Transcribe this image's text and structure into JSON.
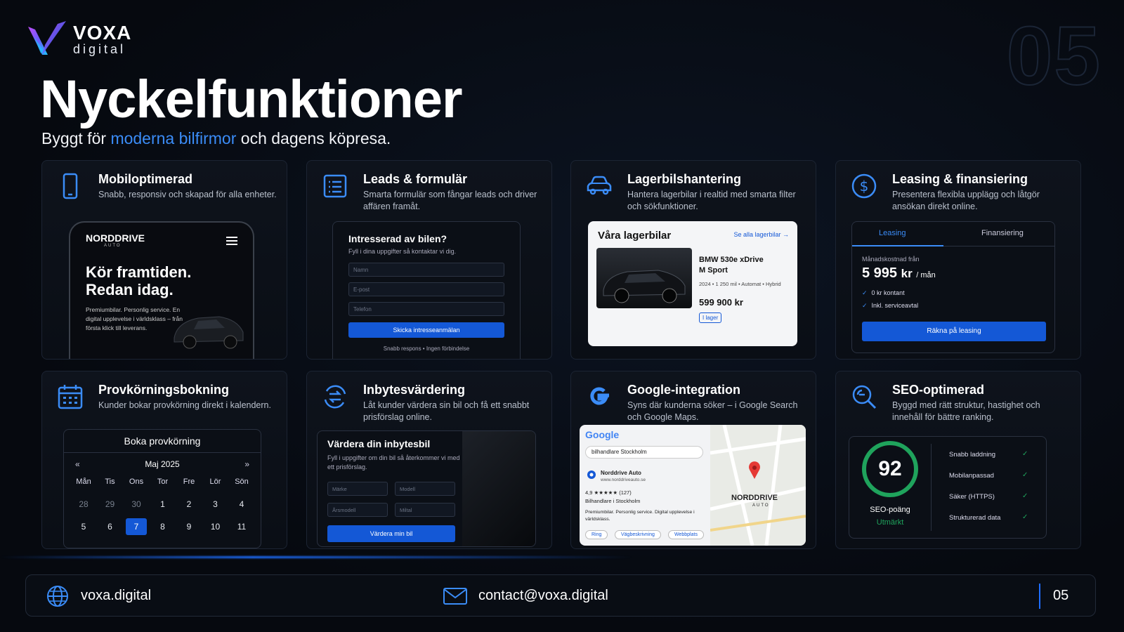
{
  "brand": {
    "name": "VOXA",
    "sub": "digital"
  },
  "page_watermark": "05",
  "title": "Nyckelfunktioner",
  "subtitle": {
    "pre": "Byggt för ",
    "highlight": "moderna bilfirmor",
    "post": " och dagens köpresa."
  },
  "colors": {
    "accent": "#3b8cf7",
    "button": "#1458d6",
    "success": "#1fa35c",
    "background": "#06090f"
  },
  "cards": {
    "mobile": {
      "icon": "phone-icon",
      "title": "Mobiloptimerad",
      "desc": "Snabb, responsiv och skapad för alla enheter.",
      "phone": {
        "brand": "NORDDRIVE",
        "brand_sub": "AUTO",
        "headline1": "Kör framtiden.",
        "headline2": "Redan idag.",
        "body": "Premiumbilar. Personlig service. En digital upplevelse i världsklass – från första klick till leverans."
      }
    },
    "leads": {
      "icon": "form-icon",
      "title": "Leads & formulär",
      "desc": "Smarta formulär som fångar leads och driver affären framåt.",
      "form": {
        "title": "Intresserad av bilen?",
        "sub": "Fyll i dina uppgifter så kontaktar vi dig.",
        "fields": [
          "Namn",
          "E-post",
          "Telefon"
        ],
        "button": "Skicka intresseanmälan",
        "note": "Snabb respons • Ingen förbindelse"
      }
    },
    "inventory": {
      "icon": "car-icon",
      "title": "Lagerbilshantering",
      "desc": "Hantera lagerbilar i realtid med smarta filter och sökfunktioner.",
      "panel": {
        "title": "Våra lagerbilar",
        "link": "Se alla lagerbilar →",
        "car_name1": "BMW 530e xDrive",
        "car_name2": "M Sport",
        "meta": "2024 • 1 250 mil • Automat • Hybrid",
        "price": "599 900 kr",
        "badge": "I lager"
      }
    },
    "leasing": {
      "icon": "dollar-icon",
      "title": "Leasing & finansiering",
      "desc": "Presentera flexibla upplägg och låtgör ansökan direkt online.",
      "panel": {
        "tab1": "Leasing",
        "tab2": "Finansiering",
        "label": "Månadskostnad från",
        "price": "5 995",
        "unit_kr": "kr",
        "unit_per": "/ mån",
        "checks": [
          "0 kr kontant",
          "Inkl. serviceavtal"
        ],
        "button": "Räkna på leasing"
      }
    },
    "testdrive": {
      "icon": "calendar-icon",
      "title": "Provkörningsbokning",
      "desc": "Kunder bokar provkörning direkt i kalendern.",
      "panel": {
        "title": "Boka provkörning",
        "month": "Maj 2025",
        "prev": "«",
        "next": "»",
        "days": [
          "Mån",
          "Tis",
          "Ons",
          "Tor",
          "Fre",
          "Lör",
          "Sön"
        ],
        "row1": [
          "28",
          "29",
          "30",
          "1",
          "2",
          "3",
          "4"
        ],
        "row2": [
          "5",
          "6",
          "7",
          "8",
          "9",
          "10",
          "11"
        ],
        "selected": "7"
      }
    },
    "tradein": {
      "icon": "exchange-icon",
      "title": "Inbytesvärdering",
      "desc": "Låt kunder värdera sin bil och få ett snabbt prisförslag online.",
      "panel": {
        "title": "Värdera din inbytesbil",
        "sub": "Fyll i uppgifter om din bil så återkommer vi med ett prisförslag.",
        "selects": [
          "Märke",
          "Modell",
          "Årsmodell",
          "Miltal"
        ],
        "button": "Värdera min bil"
      }
    },
    "google": {
      "icon": "google-icon",
      "title": "Google-integration",
      "desc": "Syns där kunderna söker – i Google Search och Google Maps.",
      "panel": {
        "logo": "Google",
        "query": "bilhandlare Stockholm",
        "business": "Norddrive Auto",
        "url": "www.norddriveauto.se",
        "rating": "4,9 ★★★★★ (127)",
        "category": "Bilhandlare i Stockholm",
        "desc": "Premiumbilar. Personlig service. Digital upplevelse i världsklass.",
        "chips": [
          "Ring",
          "Vägbeskrivning",
          "Webbplats"
        ],
        "map_label": "NORDDRIVE",
        "map_sub": "AUTO"
      }
    },
    "seo": {
      "icon": "seo-search-icon",
      "title": "SEO-optimerad",
      "desc": "Byggd med rätt struktur, hastighet och innehåll för bättre ranking.",
      "panel": {
        "score": "92",
        "score_label": "SEO-poäng",
        "score_status": "Utmärkt",
        "items": [
          "Snabb laddning",
          "Mobilanpassad",
          "Säker (HTTPS)",
          "Strukturerad data"
        ],
        "check": "✓"
      }
    }
  },
  "footer": {
    "site": "voxa.digital",
    "email": "contact@voxa.digital",
    "page": "05"
  }
}
